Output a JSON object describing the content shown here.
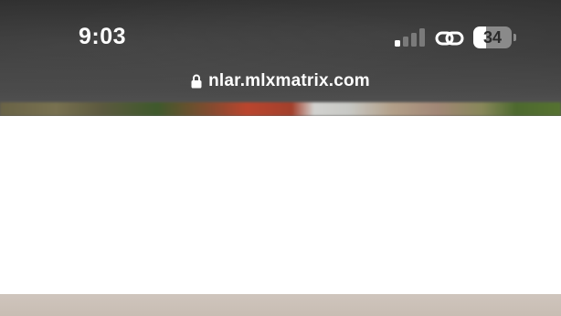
{
  "status_bar": {
    "time": "9:03",
    "signal_bars_active": 1,
    "signal_bars_total": 4,
    "battery_level": "34",
    "battery_fraction": 0.34,
    "icons": [
      "signal-icon",
      "link-icon",
      "battery-icon"
    ]
  },
  "url_bar": {
    "url": "nlar.mlxmatrix.com",
    "lock_icon": "lock-icon"
  },
  "colors": {
    "chrome_bg": "#3a3a3a",
    "text_light": "#ffffff",
    "page_bg": "#ffffff"
  }
}
